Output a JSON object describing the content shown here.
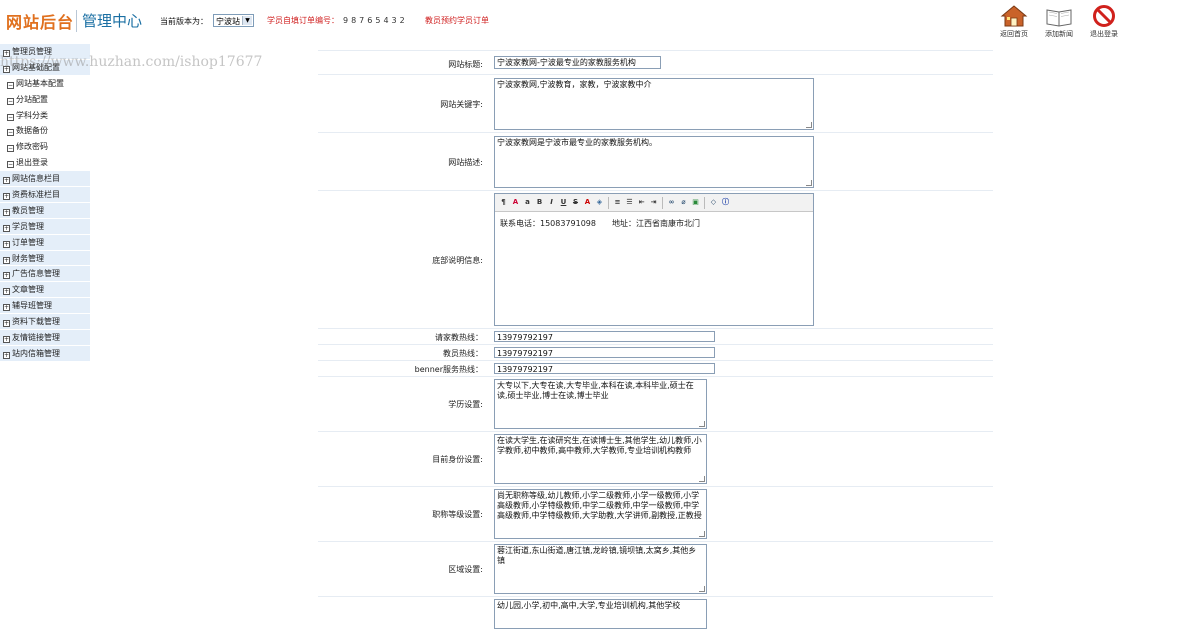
{
  "header": {
    "logo": "网站后台",
    "subtitle": "管理中心",
    "site_label": "当前版本为：",
    "site_selected": "宁波站",
    "order_label": "学员自填订单编号：",
    "order_number": "98765432",
    "order_link": "教员预约学员订单",
    "buttons": [
      {
        "label": "返回首页",
        "icon": "home-icon"
      },
      {
        "label": "添加新闻",
        "icon": "book-icon"
      },
      {
        "label": "退出登录",
        "icon": "logout-icon"
      }
    ]
  },
  "watermark": "https://www.huzhan.com/ishop17677",
  "sidebar": {
    "items": [
      {
        "label": "管理员管理",
        "type": "group"
      },
      {
        "label": "网站基础配置",
        "type": "group"
      },
      {
        "label": "网站基本配置",
        "type": "sub"
      },
      {
        "label": "分站配置",
        "type": "sub"
      },
      {
        "label": "学科分类",
        "type": "sub"
      },
      {
        "label": "数据备份",
        "type": "sub"
      },
      {
        "label": "修改密码",
        "type": "sub"
      },
      {
        "label": "退出登录",
        "type": "sub"
      },
      {
        "label": "网站信息栏目",
        "type": "group"
      },
      {
        "label": "资费标准栏目",
        "type": "group"
      },
      {
        "label": "教员管理",
        "type": "group"
      },
      {
        "label": "学员管理",
        "type": "group"
      },
      {
        "label": "订单管理",
        "type": "group"
      },
      {
        "label": "财务管理",
        "type": "group"
      },
      {
        "label": "广告信息管理",
        "type": "group"
      },
      {
        "label": "文章管理",
        "type": "group"
      },
      {
        "label": "辅导班管理",
        "type": "group"
      },
      {
        "label": "资料下载管理",
        "type": "group"
      },
      {
        "label": "友情链接管理",
        "type": "group"
      },
      {
        "label": "站内信箱管理",
        "type": "group"
      }
    ]
  },
  "form": {
    "site_title": {
      "label": "网站标题:",
      "value": "宁波家教网-宁波最专业的家教服务机构"
    },
    "keywords": {
      "label": "网站关键字:",
      "value": "宁波家教网,宁波教育，家教，宁波家教中介"
    },
    "description": {
      "label": "网站描述:",
      "value": "宁波家教网是宁波市最专业的家教服务机构。"
    },
    "footer": {
      "label": "底部说明信息:",
      "value": "联系电话：15083791098　　地址：江西省南康市北门"
    },
    "hotline_tutor": {
      "label": "请家教热线：",
      "value": "13979792197"
    },
    "hotline_teacher": {
      "label": "教员热线：",
      "value": "13979792197"
    },
    "hotline_banner": {
      "label": "benner服务热线：",
      "value": "13979792197"
    },
    "education": {
      "label": "学历设置:",
      "value": "大专以下,大专在读,大专毕业,本科在读,本科毕业,硕士在读,硕士毕业,博士在读,博士毕业"
    },
    "identity": {
      "label": "目前身份设置:",
      "value": "在读大学生,在读研究生,在读博士生,其他学生,幼儿教师,小学教师,初中教师,高中教师,大学教师,专业培训机构教师"
    },
    "rank": {
      "label": "职称等级设置:",
      "value": "尚无职称等级,幼儿教师,小学二级教师,小学一级教师,小学高级教师,小学特级教师,中学二级教师,中学一级教师,中学高级教师,中学特级教师,大学助教,大学讲师,副教授,正教授"
    },
    "region": {
      "label": "区域设置:",
      "value": "蓉江街道,东山街道,唐江镇,龙岭镇,镜坝镇,太窝乡,其他乡镇"
    },
    "grade": {
      "value": "幼儿园,小学,初中,高中,大学,专业培训机构,其他学校"
    }
  }
}
